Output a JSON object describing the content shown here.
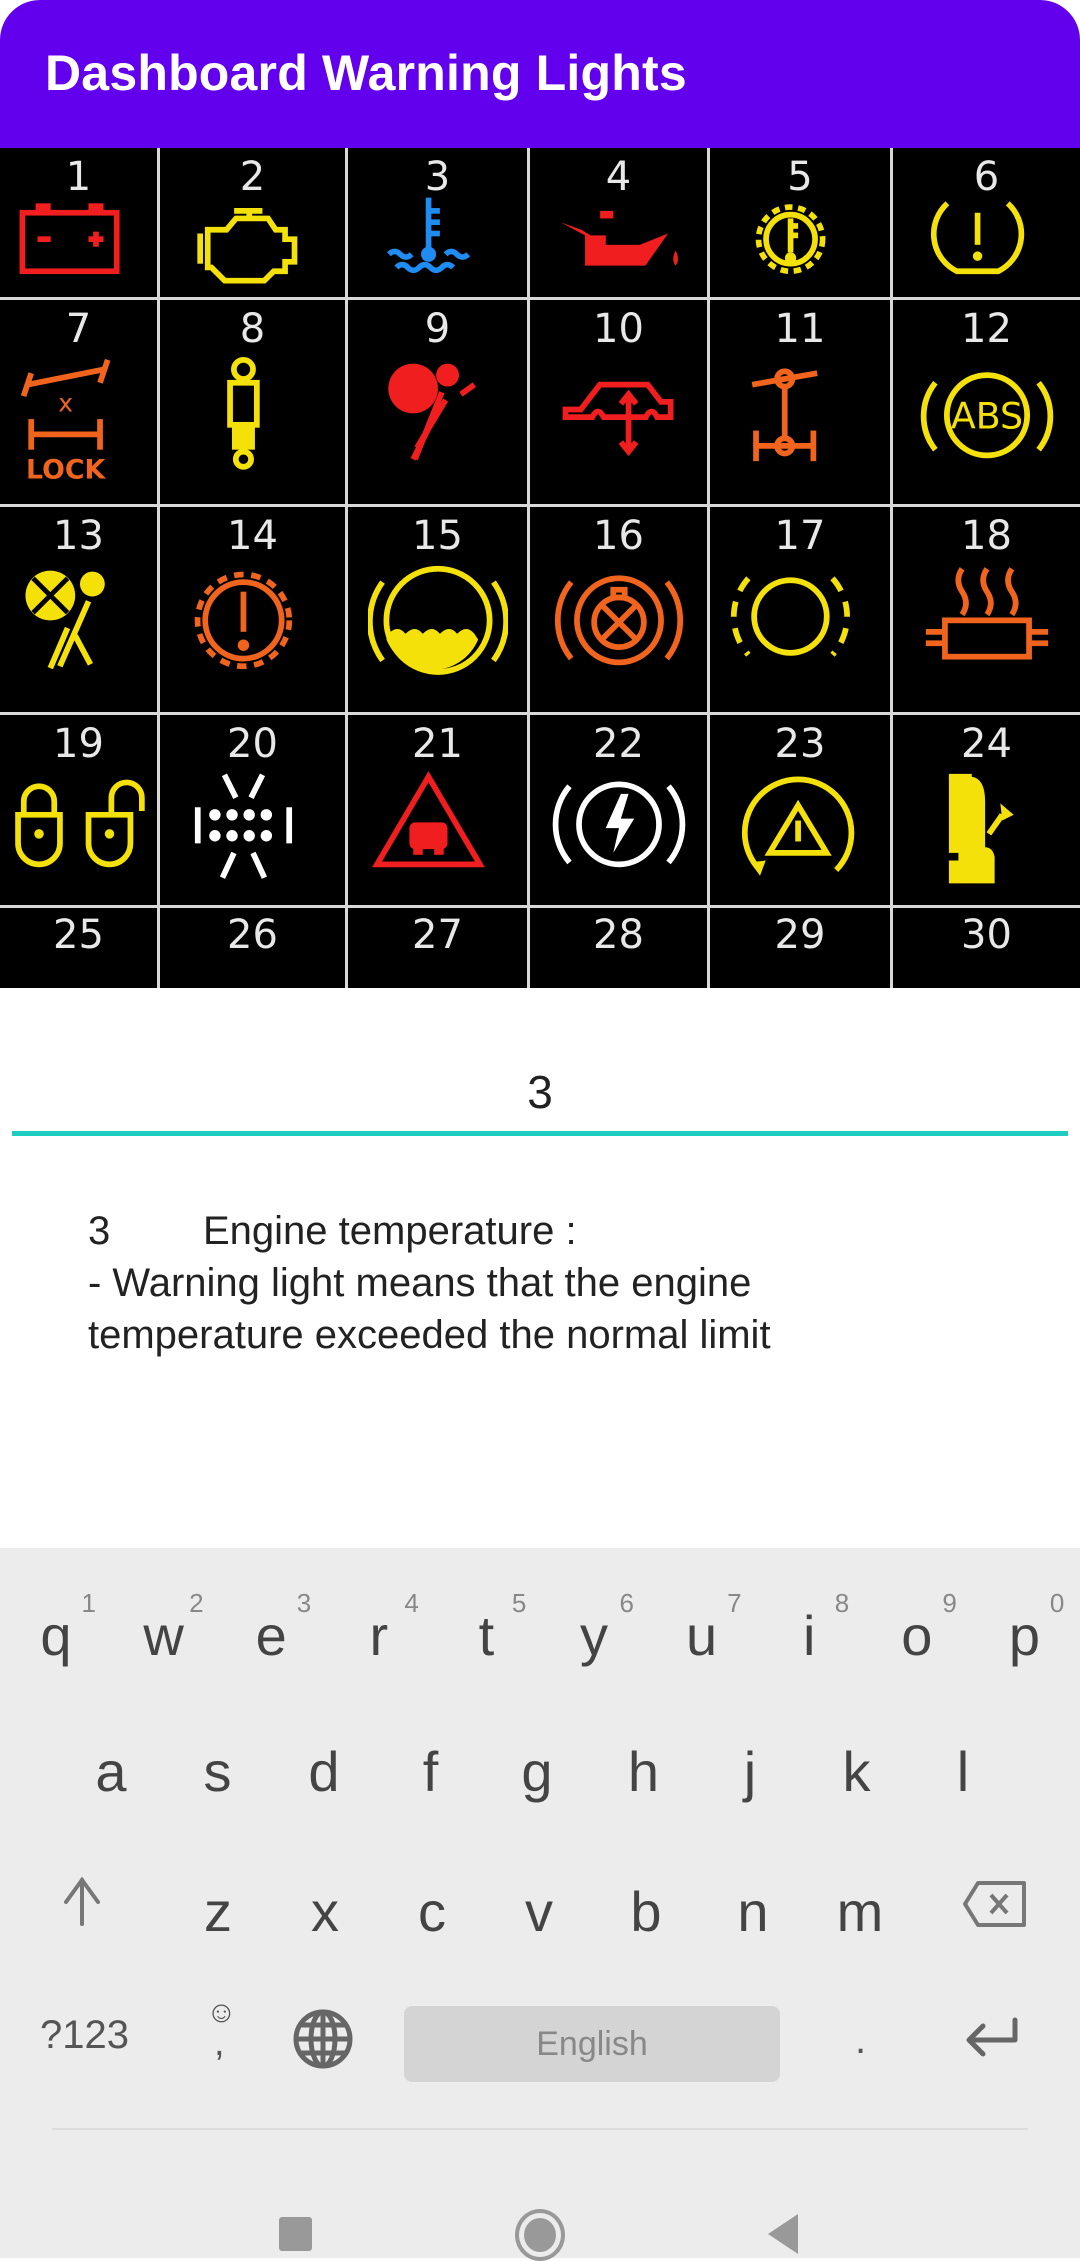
{
  "app": {
    "title": "Dashboard Warning Lights"
  },
  "colors": {
    "app_bar": "#6200EE",
    "input_underline": "#1DCDBF",
    "keyboard_bg": "#ECECEC",
    "red": "#F01E1E",
    "yellow": "#F5E10A",
    "orange": "#F0641E",
    "blue": "#1E8CF0",
    "white": "#FFFFFF"
  },
  "lights": [
    {
      "number": "1",
      "icon": "battery-icon",
      "color": "red"
    },
    {
      "number": "2",
      "icon": "check-engine-icon",
      "color": "yellow"
    },
    {
      "number": "3",
      "icon": "coolant-temperature-icon",
      "color": "blue"
    },
    {
      "number": "4",
      "icon": "oil-pressure-icon",
      "color": "red"
    },
    {
      "number": "5",
      "icon": "transmission-temperature-icon",
      "color": "yellow"
    },
    {
      "number": "6",
      "icon": "tire-pressure-icon",
      "color": "yellow"
    },
    {
      "number": "7",
      "icon": "differential-lock-icon",
      "color": "orange",
      "caption": "LOCK"
    },
    {
      "number": "8",
      "icon": "shock-absorber-icon",
      "color": "yellow"
    },
    {
      "number": "9",
      "icon": "airbag-icon",
      "color": "red"
    },
    {
      "number": "10",
      "icon": "suspension-icon",
      "color": "red"
    },
    {
      "number": "11",
      "icon": "four-wheel-drive-icon",
      "color": "orange"
    },
    {
      "number": "12",
      "icon": "abs-icon",
      "color": "yellow",
      "caption": "ABS"
    },
    {
      "number": "13",
      "icon": "airbag-off-icon",
      "color": "yellow"
    },
    {
      "number": "14",
      "icon": "transmission-fault-icon",
      "color": "orange"
    },
    {
      "number": "15",
      "icon": "brake-fluid-icon",
      "color": "yellow"
    },
    {
      "number": "16",
      "icon": "brake-wear-icon",
      "color": "orange"
    },
    {
      "number": "17",
      "icon": "brake-pad-icon",
      "color": "yellow"
    },
    {
      "number": "18",
      "icon": "exhaust-filter-icon",
      "color": "orange"
    },
    {
      "number": "19",
      "icon": "child-lock-icon",
      "color": "yellow"
    },
    {
      "number": "20",
      "icon": "rear-defrost-icon",
      "color": "white"
    },
    {
      "number": "21",
      "icon": "collision-warning-icon",
      "color": "red"
    },
    {
      "number": "22",
      "icon": "electric-brake-icon",
      "color": "white"
    },
    {
      "number": "23",
      "icon": "stability-control-icon",
      "color": "yellow"
    },
    {
      "number": "24",
      "icon": "fuel-door-icon",
      "color": "yellow"
    },
    {
      "number": "25"
    },
    {
      "number": "26"
    },
    {
      "number": "27"
    },
    {
      "number": "28"
    },
    {
      "number": "29"
    },
    {
      "number": "30"
    }
  ],
  "search": {
    "value": "3"
  },
  "result": {
    "number": "3",
    "title": "Engine temperature :",
    "line1": "- Warning light means that the engine",
    "line2": "temperature exceeded the normal limit"
  },
  "keyboard": {
    "row1": [
      {
        "ch": "q",
        "hint": "1"
      },
      {
        "ch": "w",
        "hint": "2"
      },
      {
        "ch": "e",
        "hint": "3"
      },
      {
        "ch": "r",
        "hint": "4"
      },
      {
        "ch": "t",
        "hint": "5"
      },
      {
        "ch": "y",
        "hint": "6"
      },
      {
        "ch": "u",
        "hint": "7"
      },
      {
        "ch": "i",
        "hint": "8"
      },
      {
        "ch": "o",
        "hint": "9"
      },
      {
        "ch": "p",
        "hint": "0"
      }
    ],
    "row2": [
      "a",
      "s",
      "d",
      "f",
      "g",
      "h",
      "j",
      "k",
      "l"
    ],
    "row3": [
      "z",
      "x",
      "c",
      "v",
      "b",
      "n",
      "m"
    ],
    "symbols_label": "?123",
    "comma": ",",
    "space_label": "English",
    "period": "."
  }
}
